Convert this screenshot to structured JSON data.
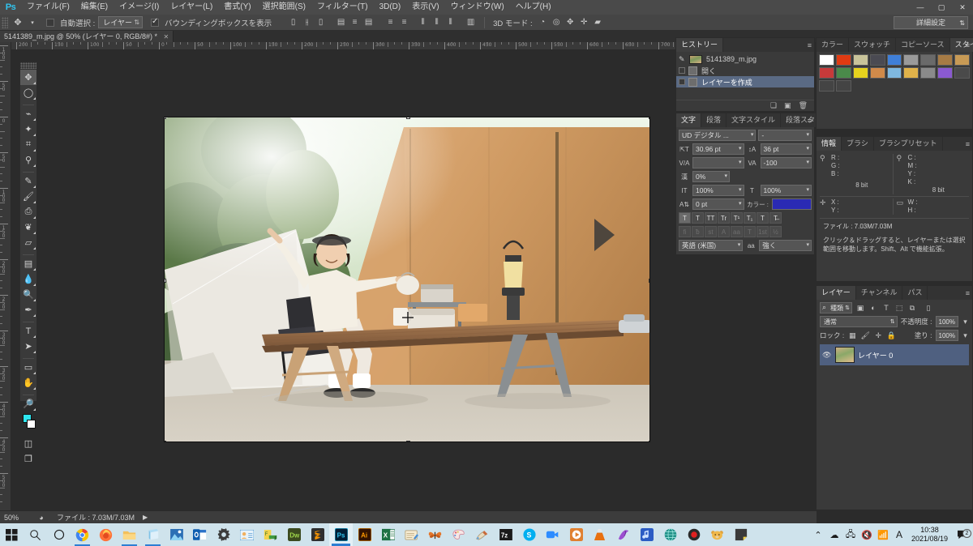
{
  "app": {
    "name": "Ps",
    "logo_text": "Ps"
  },
  "menubar": {
    "items": [
      {
        "label": "ファイル(F)"
      },
      {
        "label": "編集(E)"
      },
      {
        "label": "イメージ(I)"
      },
      {
        "label": "レイヤー(L)"
      },
      {
        "label": "書式(Y)"
      },
      {
        "label": "選択範囲(S)"
      },
      {
        "label": "フィルター(T)"
      },
      {
        "label": "3D(D)"
      },
      {
        "label": "表示(V)"
      },
      {
        "label": "ウィンドウ(W)"
      },
      {
        "label": "ヘルプ(H)"
      }
    ],
    "window_controls": {
      "minimize": "—",
      "maximize": "▢",
      "close": "✕"
    }
  },
  "options_bar": {
    "tool_icon": "move-tool",
    "auto_select_label": "自動選択 :",
    "auto_select_value": "レイヤー",
    "show_bounding_box_label": "バウンディングボックスを表示",
    "show_bounding_box_checked": true,
    "mode_3d_label": "3D モード :",
    "workspace_value": "詳細設定"
  },
  "document_tab": {
    "title": "5141389_m.jpg @ 50% (レイヤー 0, RGB/8#) *",
    "close": "✕"
  },
  "rulers": {
    "horizontal": [
      "200",
      "150",
      "100",
      "50",
      "0",
      "50",
      "100",
      "150",
      "200",
      "250",
      "300",
      "350",
      "400",
      "450",
      "500",
      "550",
      "600",
      "650",
      "700"
    ],
    "vertical": [
      "100",
      "50",
      "0",
      "50",
      "100",
      "150",
      "200",
      "250",
      "300",
      "350",
      "400",
      "450",
      "500"
    ]
  },
  "toolbox": {
    "tools": [
      {
        "name": "move-tool",
        "glyph": "✥",
        "active": true
      },
      {
        "name": "elliptical-marquee-tool",
        "glyph": "◯"
      },
      {
        "name": "lasso-tool",
        "glyph": "⌁"
      },
      {
        "name": "magic-wand-tool",
        "glyph": "✦"
      },
      {
        "name": "crop-tool",
        "glyph": "⌗"
      },
      {
        "name": "eyedropper-tool",
        "glyph": "⚲"
      },
      {
        "name": "spot-healing-brush-tool",
        "glyph": "✎"
      },
      {
        "name": "brush-tool",
        "glyph": "🖌"
      },
      {
        "name": "clone-stamp-tool",
        "glyph": "⎙"
      },
      {
        "name": "history-brush-tool",
        "glyph": "❦"
      },
      {
        "name": "eraser-tool",
        "glyph": "▱"
      },
      {
        "name": "gradient-tool",
        "glyph": "▤"
      },
      {
        "name": "blur-tool",
        "glyph": "💧"
      },
      {
        "name": "dodge-tool",
        "glyph": "🔍"
      },
      {
        "name": "pen-tool",
        "glyph": "✒"
      },
      {
        "name": "type-tool",
        "glyph": "T"
      },
      {
        "name": "path-selection-tool",
        "glyph": "➤"
      },
      {
        "name": "rectangle-tool",
        "glyph": "▭"
      },
      {
        "name": "hand-tool",
        "glyph": "✋"
      },
      {
        "name": "zoom-tool",
        "glyph": "🔎"
      }
    ],
    "foreground_color": "#2ee6ef",
    "background_color": "#ffffff",
    "quick_mask_glyph": "◫",
    "screen_mode_glyph": "❐"
  },
  "history_panel": {
    "tab": "ヒストリー",
    "items": [
      {
        "label": "5141389_m.jpg",
        "type": "snapshot",
        "selected": false
      },
      {
        "label": "開く",
        "type": "state",
        "selected": false
      },
      {
        "label": "レイヤーを作成",
        "type": "state",
        "selected": true
      }
    ],
    "footer_icons": [
      "new-document-icon",
      "new-snapshot-icon",
      "delete-icon"
    ]
  },
  "character_panel": {
    "tabs": [
      {
        "label": "文字",
        "active": true
      },
      {
        "label": "段落",
        "active": false
      },
      {
        "label": "文字スタイル",
        "active": false
      },
      {
        "label": "段落スタイル",
        "active": false
      }
    ],
    "font_family": "UD デジタル ...",
    "font_style": "-",
    "font_size": "30.96 pt",
    "leading": "36 pt",
    "kerning": "",
    "tracking": "-100",
    "vertical_scale_pct": "0%",
    "horizontal_scale": "100%",
    "vertical_scale": "100%",
    "baseline_shift": "0 pt",
    "color_label": "カラー :",
    "color_value": "#2a2ab4",
    "style_buttons": [
      "T",
      "T",
      "TT",
      "Tr",
      "T¹",
      "T₁",
      "T",
      "T̶"
    ],
    "ot_buttons": [
      "fi",
      "ᵬ",
      "st",
      "A",
      "aa",
      "T",
      "1st",
      "½"
    ],
    "language": "英語 (米国)",
    "antialias": "強く"
  },
  "styles_panel": {
    "tabs": [
      {
        "label": "カラー",
        "active": false
      },
      {
        "label": "スウォッチ",
        "active": false
      },
      {
        "label": "コピーソース",
        "active": false
      },
      {
        "label": "スタイル",
        "active": true
      }
    ],
    "swatches_row1": [
      "#ffffff",
      "#e03a12",
      "#c9c49a",
      "#4a4a52",
      "#3f7fd8",
      "#9a9a9a",
      "#6a6a6a",
      "#a67b45",
      "#c89a55"
    ],
    "swatches_row2": [
      "#c73a3a",
      "#4a8a4a",
      "#e6d21e",
      "#d08a4a",
      "#7fb8e0",
      "#e0b24a",
      "#8a8a8a",
      "#8a5ad0",
      "#4a4a4a"
    ],
    "swatches_row3": [
      "#444444",
      "#444444"
    ]
  },
  "info_panel": {
    "tabs": [
      {
        "label": "情報",
        "active": true
      },
      {
        "label": "ブラシ",
        "active": false
      },
      {
        "label": "ブラシプリセット",
        "active": false
      }
    ],
    "rgb": {
      "r": "R :",
      "g": "G :",
      "b": "B :",
      "depth": "8 bit"
    },
    "cmyk": {
      "c": "C :",
      "m": "M :",
      "y": "Y :",
      "k": "K :",
      "depth": "8 bit"
    },
    "coords": {
      "x": "X :",
      "y": "Y :"
    },
    "size": {
      "w": "W :",
      "h": "H :"
    },
    "file_label": "ファイル : 7.03M/7.03M",
    "hint": "クリック＆ドラッグすると、レイヤーまたは選択範囲を移動します。Shift、Alt で機能拡張。"
  },
  "layers_panel": {
    "tabs": [
      {
        "label": "レイヤー",
        "active": true
      },
      {
        "label": "チャンネル",
        "active": false
      },
      {
        "label": "パス",
        "active": false
      }
    ],
    "filter_label": "種類",
    "filter_icons": [
      "pixel-filter-icon",
      "adjustment-filter-icon",
      "type-filter-icon",
      "shape-filter-icon",
      "smart-object-filter-icon"
    ],
    "blend_mode": "通常",
    "opacity_label": "不透明度 :",
    "opacity_value": "100%",
    "lock_label": "ロック :",
    "lock_icons": [
      "lock-transparent-icon",
      "lock-image-icon",
      "lock-position-icon",
      "lock-all-icon"
    ],
    "fill_label": "塗り :",
    "fill_value": "100%",
    "layers": [
      {
        "name": "レイヤー 0",
        "visible": true,
        "selected": true
      }
    ]
  },
  "status_bar": {
    "zoom": "50%",
    "file_info": "ファイル : 7.03M/7.03M",
    "arrow": "▶"
  },
  "taskbar": {
    "start_icon": "windows-start-icon",
    "search_icon": "search-icon",
    "cortana_icon": "cortana-circle-icon",
    "apps": [
      {
        "name": "chrome-icon",
        "running": true
      },
      {
        "name": "firefox-icon",
        "running": false
      },
      {
        "name": "file-explorer-icon",
        "running": true
      },
      {
        "name": "onenote-icon",
        "running": true
      },
      {
        "name": "photos-icon",
        "running": false
      },
      {
        "name": "outlook-icon",
        "running": false
      },
      {
        "name": "settings-icon",
        "running": false
      },
      {
        "name": "contacts-icon",
        "running": false
      },
      {
        "name": "ftp-icon",
        "running": false
      },
      {
        "name": "dreamweaver-icon",
        "running": false
      },
      {
        "name": "sublime-text-icon",
        "running": false
      },
      {
        "name": "photoshop-icon",
        "running": true,
        "focused": true
      },
      {
        "name": "illustrator-icon",
        "running": false
      },
      {
        "name": "excel-icon",
        "running": false
      },
      {
        "name": "notepad-icon",
        "running": false
      },
      {
        "name": "butterfly-icon",
        "running": false
      },
      {
        "name": "paint-palette-icon",
        "running": false
      },
      {
        "name": "paint-brush-icon",
        "running": false
      },
      {
        "name": "7zip-icon",
        "running": false
      },
      {
        "name": "skype-icon",
        "running": false
      },
      {
        "name": "zoom-icon",
        "running": false
      },
      {
        "name": "media-player-icon",
        "running": false
      },
      {
        "name": "vlc-icon",
        "running": false
      },
      {
        "name": "filezilla-icon",
        "running": false
      },
      {
        "name": "music-icon",
        "running": false
      },
      {
        "name": "globe-icon",
        "running": false
      },
      {
        "name": "record-icon",
        "running": false
      },
      {
        "name": "bear-icon",
        "running": false
      },
      {
        "name": "sticky-notes-icon",
        "running": false
      }
    ],
    "tray": {
      "expand": "⌃",
      "icons": [
        "onedrive-icon",
        "network-icon",
        "volume-muted-icon",
        "wifi-icon",
        "ime-a-icon"
      ],
      "ime": "A",
      "time": "10:38",
      "date": "2021/08/19",
      "notification_count": "2"
    }
  },
  "canvas": {
    "image_title": "camping-tent-photo",
    "zoom_level": "50%"
  }
}
